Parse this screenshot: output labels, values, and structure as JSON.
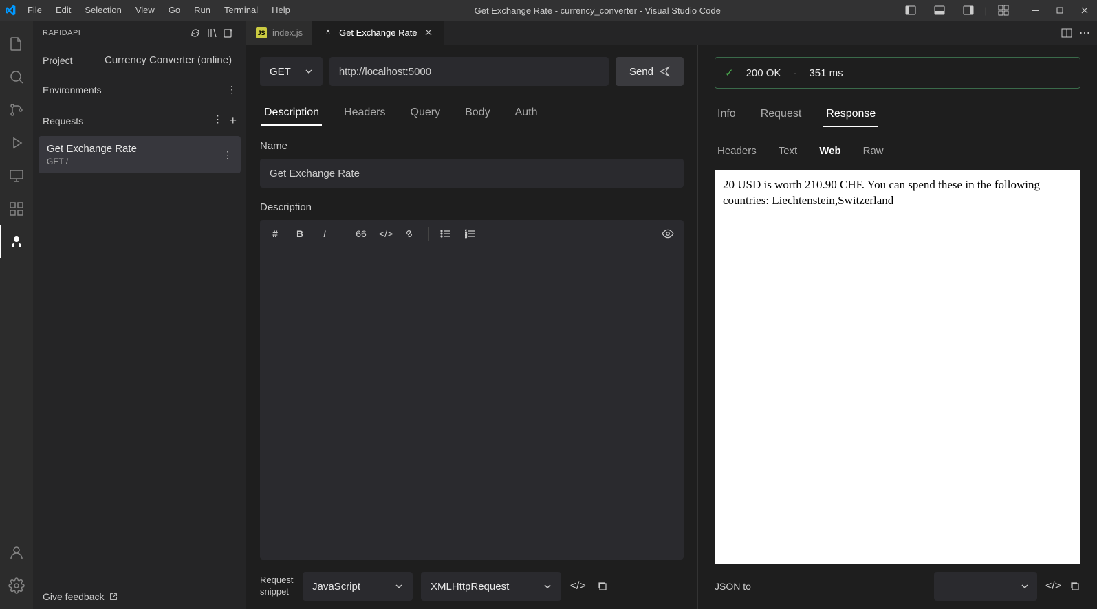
{
  "menu": [
    "File",
    "Edit",
    "Selection",
    "View",
    "Go",
    "Run",
    "Terminal",
    "Help"
  ],
  "window_title": "Get Exchange Rate - currency_converter - Visual Studio Code",
  "sidebar": {
    "title": "RAPIDAPI",
    "project_label": "Project",
    "project_value": "Currency Converter (online)",
    "env_label": "Environments",
    "requests_label": "Requests",
    "request_item": {
      "name": "Get Exchange Rate",
      "meta": "GET /"
    },
    "feedback": "Give feedback"
  },
  "tabs": [
    {
      "label": "index.js",
      "icon": "js"
    },
    {
      "label": "Get Exchange Rate",
      "icon": "rapidapi"
    }
  ],
  "request": {
    "method": "GET",
    "url": "http://localhost:5000",
    "send_label": "Send",
    "tabs": [
      "Description",
      "Headers",
      "Query",
      "Body",
      "Auth"
    ],
    "name_label": "Name",
    "name_value": "Get Exchange Rate",
    "desc_label": "Description",
    "snippet_label": "Request snippet",
    "snippet_lang": "JavaScript",
    "snippet_lib": "XMLHttpRequest"
  },
  "response": {
    "status_code": "200 OK",
    "time": "351 ms",
    "tabs": [
      "Info",
      "Request",
      "Response"
    ],
    "subtabs": [
      "Headers",
      "Text",
      "Web",
      "Raw"
    ],
    "web_body": "20 USD is worth 210.90 CHF. You can spend these in the following countries: Liechtenstein,Switzerland",
    "json_to_label": "JSON to"
  }
}
